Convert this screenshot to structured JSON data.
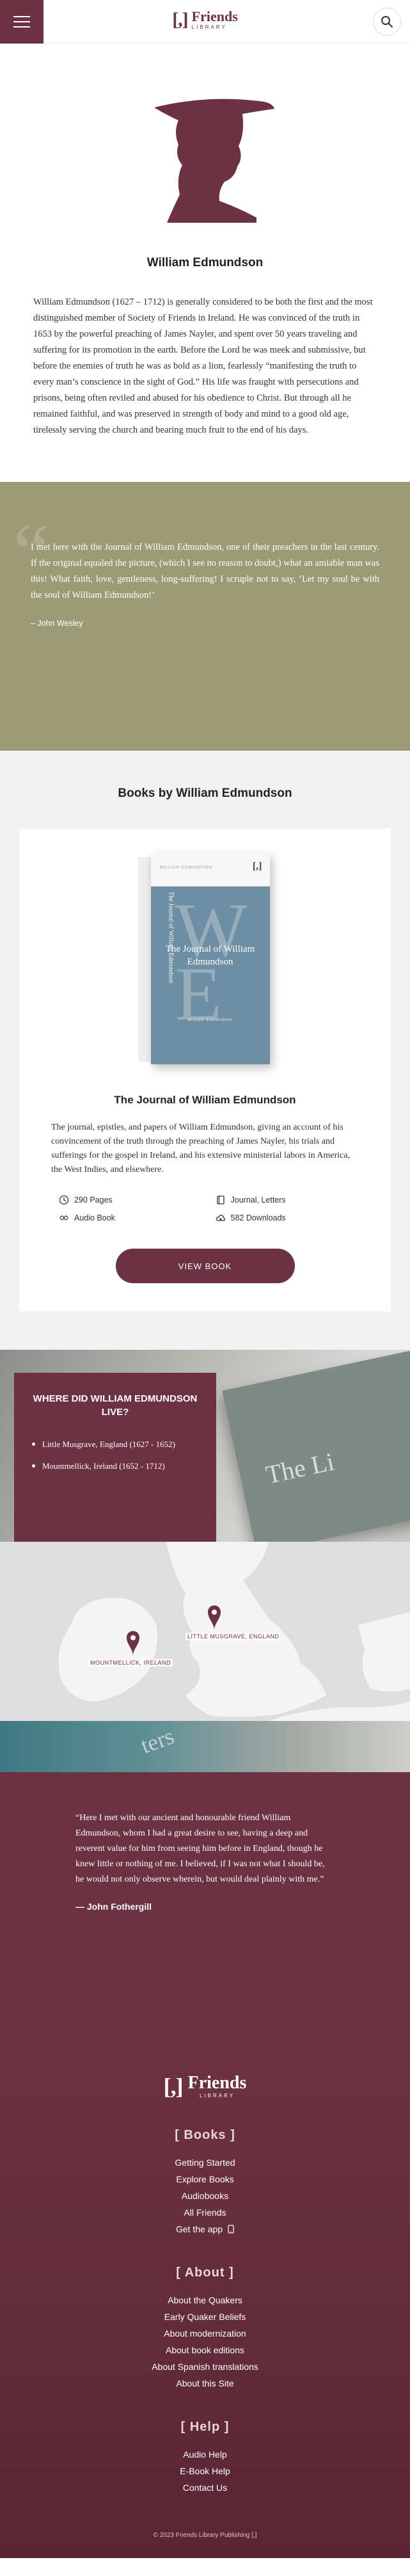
{
  "header": {
    "logo_mark": "[,]",
    "logo_line1": "Friends",
    "logo_line2": "LIBRARY"
  },
  "author": {
    "name": "William Edmundson",
    "bio": "William Edmundson (1627 – 1712) is generally considered to be both the first and the most distinguished member of Society of Friends in Ireland. He was convinced of the truth in 1653 by the powerful preaching of James Nayler, and spent over 50 years traveling and suffering for its promotion in the earth. Before the Lord he was meek and submissive, but before the enemies of truth he was as bold as a lion, fearlessly “manifesting the truth to every man’s conscience in the sight of God.” His life was fraught with persecutions and prisons, being often reviled and abused for his obedience to Christ. But through all he remained faithful, and was preserved in strength of body and mind to a good old age, tirelessly serving the church and bearing much fruit to the end of his days."
  },
  "quote1": {
    "mark": "“",
    "text": "I met here with the Journal of William Edmundson, one of their preachers in the last century. If the original equaled the picture, (which I see no reason to doubt,) what an amiable man was this! What faith, love, gentleness, long-suffering! I scruple not to say, ‘Let my soul be with the soul of William Edmundson!’",
    "by": "– John Wesley"
  },
  "books": {
    "heading": "Books by William Edmundson",
    "items": [
      {
        "cover_series": "WILLIAM EDMUNDSON",
        "cover_letters": "W E",
        "cover_title": "The Journal of William Edmundson",
        "cover_author": "William Edmundson",
        "spine_text": "The Journal of William Edmundson",
        "title": "The Journal of William Edmundson",
        "description": "The journal, epistles, and papers of William Edmundson, giving an account of his convincement of the truth through the preaching of James Nayler, his trials and sufferings for the gospel in Ireland, and his extensive ministerial labors in America, the West Indies, and elsewhere.",
        "pages": "290 Pages",
        "genre": "Journal, Letters",
        "audio": "Audio Book",
        "downloads": "582 Downloads",
        "button": "View Book"
      }
    ]
  },
  "where": {
    "bg_text": "The Li",
    "title": "Where did William Edmundson live?",
    "places": [
      "Little Musgrave, England (1627 - 1652)",
      "Mountmellick, Ireland (1652 - 1712)"
    ]
  },
  "map": {
    "label1": "LITTLE MUSGRAVE, ENGLAND",
    "label2": "MOUNTMELLICK, IRELAND"
  },
  "quote2": {
    "strip_text": "ters",
    "text": "“Here I met with our ancient and honourable friend William Edmundson, whom I had a great desire to see, having a deep and reverent value for him from seeing him before in England, though he knew little or nothing of me. I believed, if I was not what I should be, he would not only observe wherein, but would deal plainly with me.”",
    "by": "— John Fothergill"
  },
  "footer": {
    "logo_mark": "[,]",
    "logo_line1": "Friends",
    "logo_line2": "LIBRARY",
    "sections": [
      {
        "heading": "[ Books ]",
        "links": [
          "Getting Started",
          "Explore Books",
          "Audiobooks",
          "All Friends",
          "Get the app"
        ]
      },
      {
        "heading": "[ About ]",
        "links": [
          "About the Quakers",
          "Early Quaker Beliefs",
          "About modernization",
          "About book editions",
          "About Spanish translations",
          "About this Site"
        ]
      },
      {
        "heading": "[ Help ]",
        "links": [
          "Audio Help",
          "E-Book Help",
          "Contact Us"
        ]
      }
    ],
    "copyright": "© 2023 Friends Library Publishing [,]"
  },
  "colors": {
    "brand": "#6c3142",
    "olive": "#9b9b76",
    "cover_blue": "#6e8ea3"
  }
}
